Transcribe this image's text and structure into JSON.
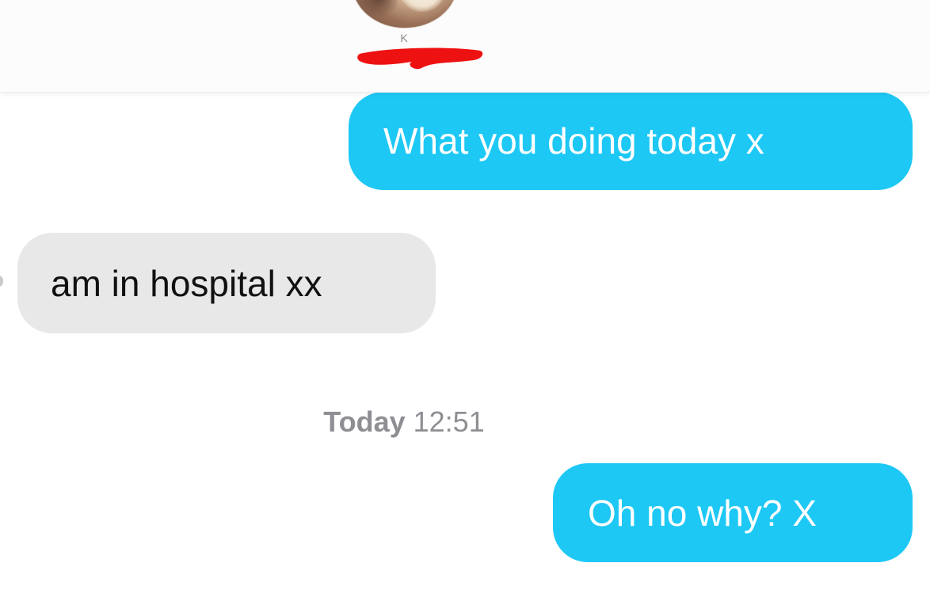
{
  "header": {
    "contact_name": "K",
    "name_redacted": true
  },
  "thread": {
    "messages": [
      {
        "direction": "outgoing",
        "text": "What you doing today x"
      },
      {
        "direction": "incoming",
        "text": "am in hospital xx"
      },
      {
        "direction": "outgoing",
        "text": "Oh no why? X"
      }
    ],
    "timestamp": {
      "day": "Today",
      "time": "12:51"
    }
  },
  "colors": {
    "outgoing_bubble": "#1dc8f5",
    "incoming_bubble": "#e8e8e8",
    "timestamp_text": "#8e8e93",
    "redaction": "#ee1111"
  }
}
